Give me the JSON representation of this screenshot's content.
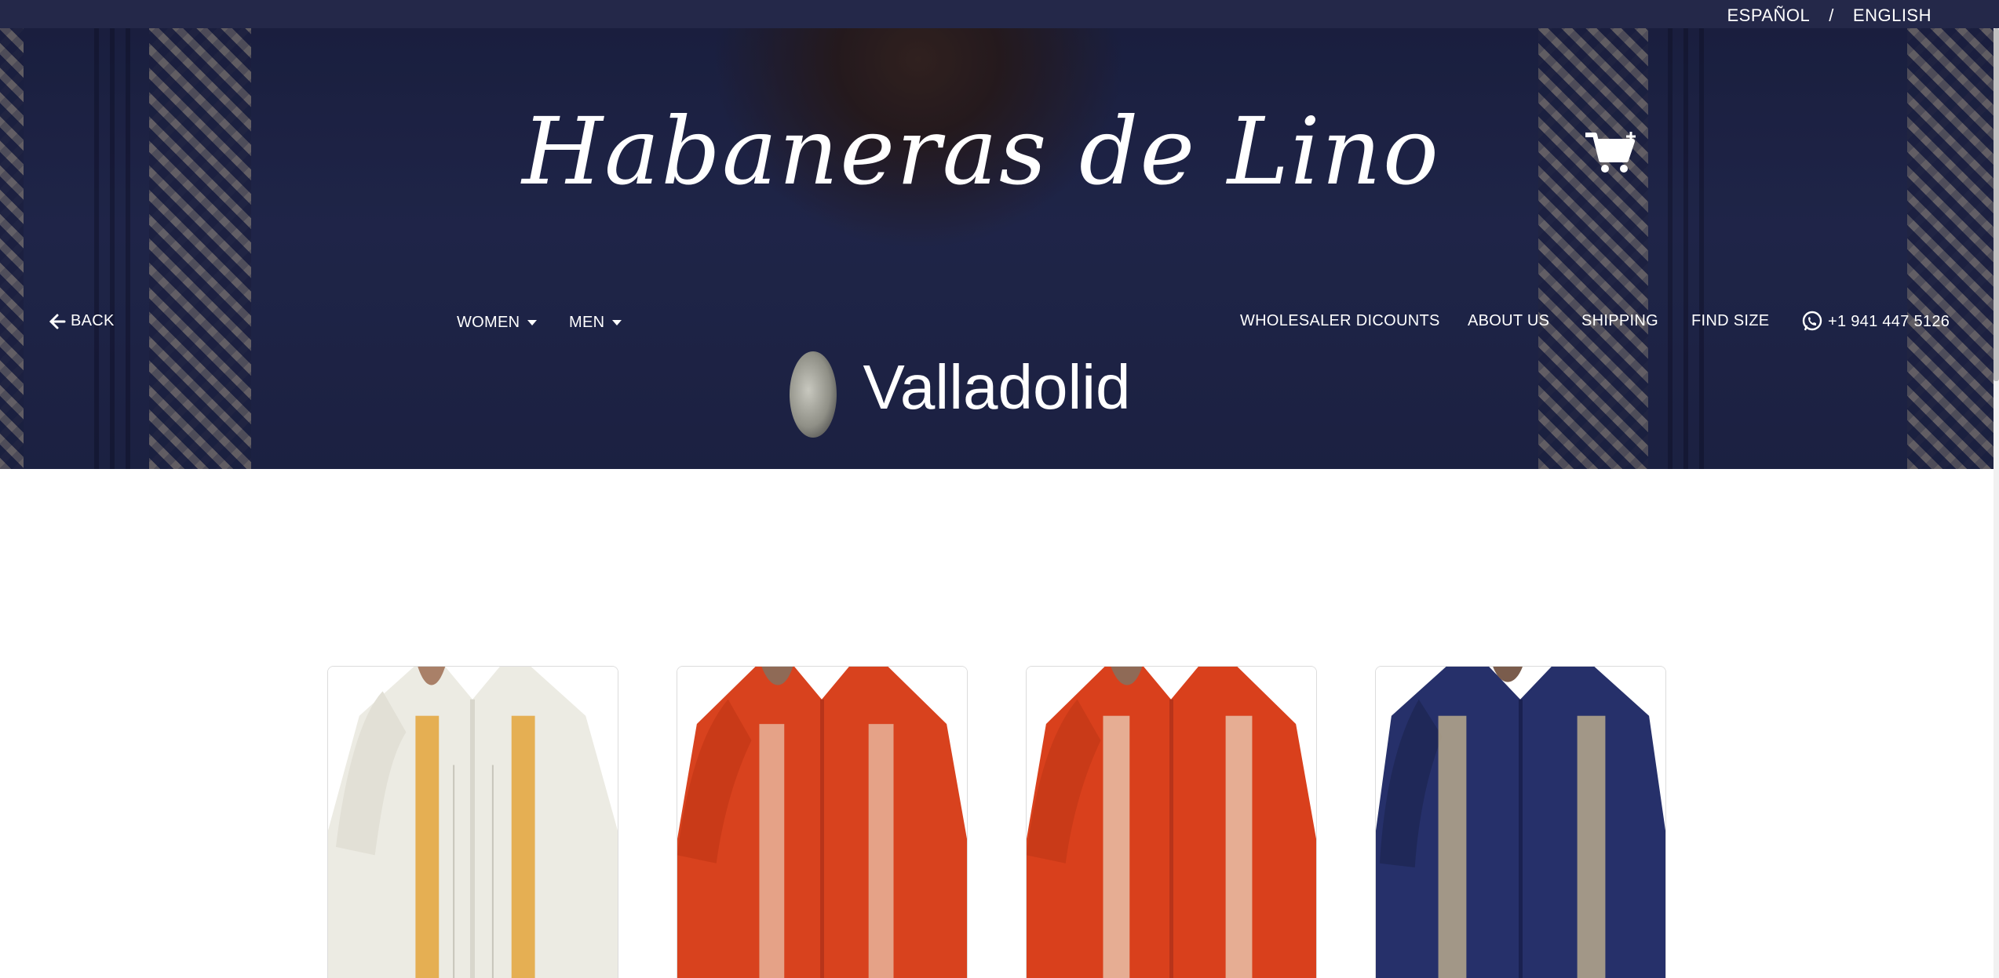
{
  "language_bar": {
    "espanol": "ESPAÑOL",
    "separator": "/",
    "english": "ENGLISH",
    "background": "#242849"
  },
  "header": {
    "brand": "Habaneras de Lino",
    "cart_icon": "cart-plus-icon"
  },
  "nav": {
    "back": "BACK",
    "women": "WOMEN",
    "men": "MEN",
    "wholesaler": "WHOLESALER DICOUNTS",
    "about": "ABOUT US",
    "shipping": "SHIPPING",
    "find_size": "FIND SIZE",
    "phone": "+1 941 447 5126",
    "phone_icon": "whatsapp-icon"
  },
  "page": {
    "title": "Valladolid"
  },
  "products": [
    {
      "color": "cream",
      "accent": "#e4a43a",
      "base": "#ecebe3"
    },
    {
      "color": "red",
      "accent": "#e8b39a",
      "base": "#d8421e"
    },
    {
      "color": "red",
      "accent": "#e8c1a8",
      "base": "#d9401c"
    },
    {
      "color": "navy",
      "accent": "#b8a98c",
      "base": "#26306a"
    }
  ]
}
